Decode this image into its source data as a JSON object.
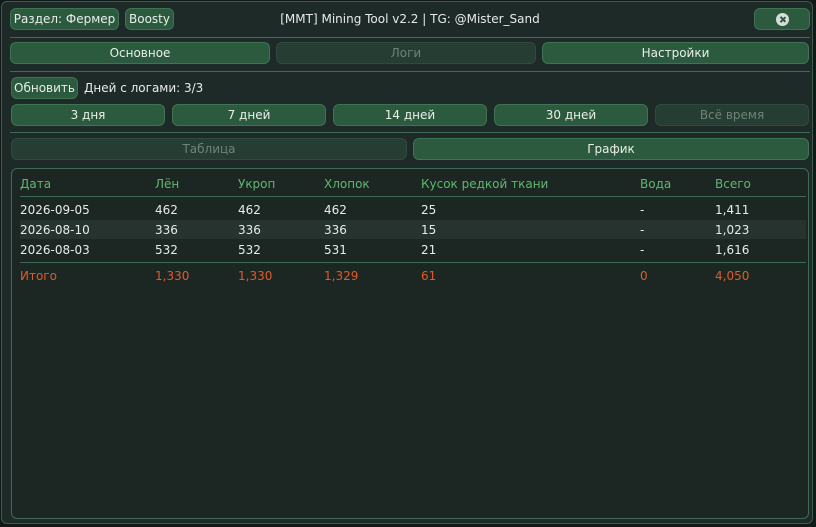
{
  "header": {
    "section_button": "Раздел: Фермер",
    "boosty_button": "Boosty",
    "title": "[MMT] Mining Tool v2.2 | TG: @Mister_Sand"
  },
  "tabs": [
    {
      "label": "Основное",
      "active": true
    },
    {
      "label": "Логи",
      "active": false
    },
    {
      "label": "Настройки",
      "active": true
    }
  ],
  "toolbar": {
    "refresh_label": "Обновить",
    "days_with_logs": "Дней с логами: 3/3"
  },
  "periods": [
    {
      "label": "3 дня",
      "enabled": true
    },
    {
      "label": "7 дней",
      "enabled": true
    },
    {
      "label": "14 дней",
      "enabled": true
    },
    {
      "label": "30 дней",
      "enabled": true
    },
    {
      "label": "Всё время",
      "enabled": false
    }
  ],
  "views": [
    {
      "label": "Таблица",
      "enabled": false
    },
    {
      "label": "График",
      "enabled": true
    }
  ],
  "table": {
    "columns": [
      "Дата",
      "Лён",
      "Укроп",
      "Хлопок",
      "Кусок редкой ткани",
      "Вода",
      "Всего"
    ],
    "rows": [
      [
        "2026-09-05",
        "462",
        "462",
        "462",
        "25",
        "-",
        "1,411"
      ],
      [
        "2026-08-10",
        "336",
        "336",
        "336",
        "15",
        "-",
        "1,023"
      ],
      [
        "2026-08-03",
        "532",
        "532",
        "531",
        "21",
        "-",
        "1,616"
      ]
    ],
    "totals": [
      "Итого",
      "1,330",
      "1,330",
      "1,329",
      "61",
      "0",
      "4,050"
    ]
  },
  "colors": {
    "accent": "#2c5a3f",
    "header_text": "#5fb86d",
    "total_text": "#e05a2a",
    "background": "#1e2a27"
  }
}
